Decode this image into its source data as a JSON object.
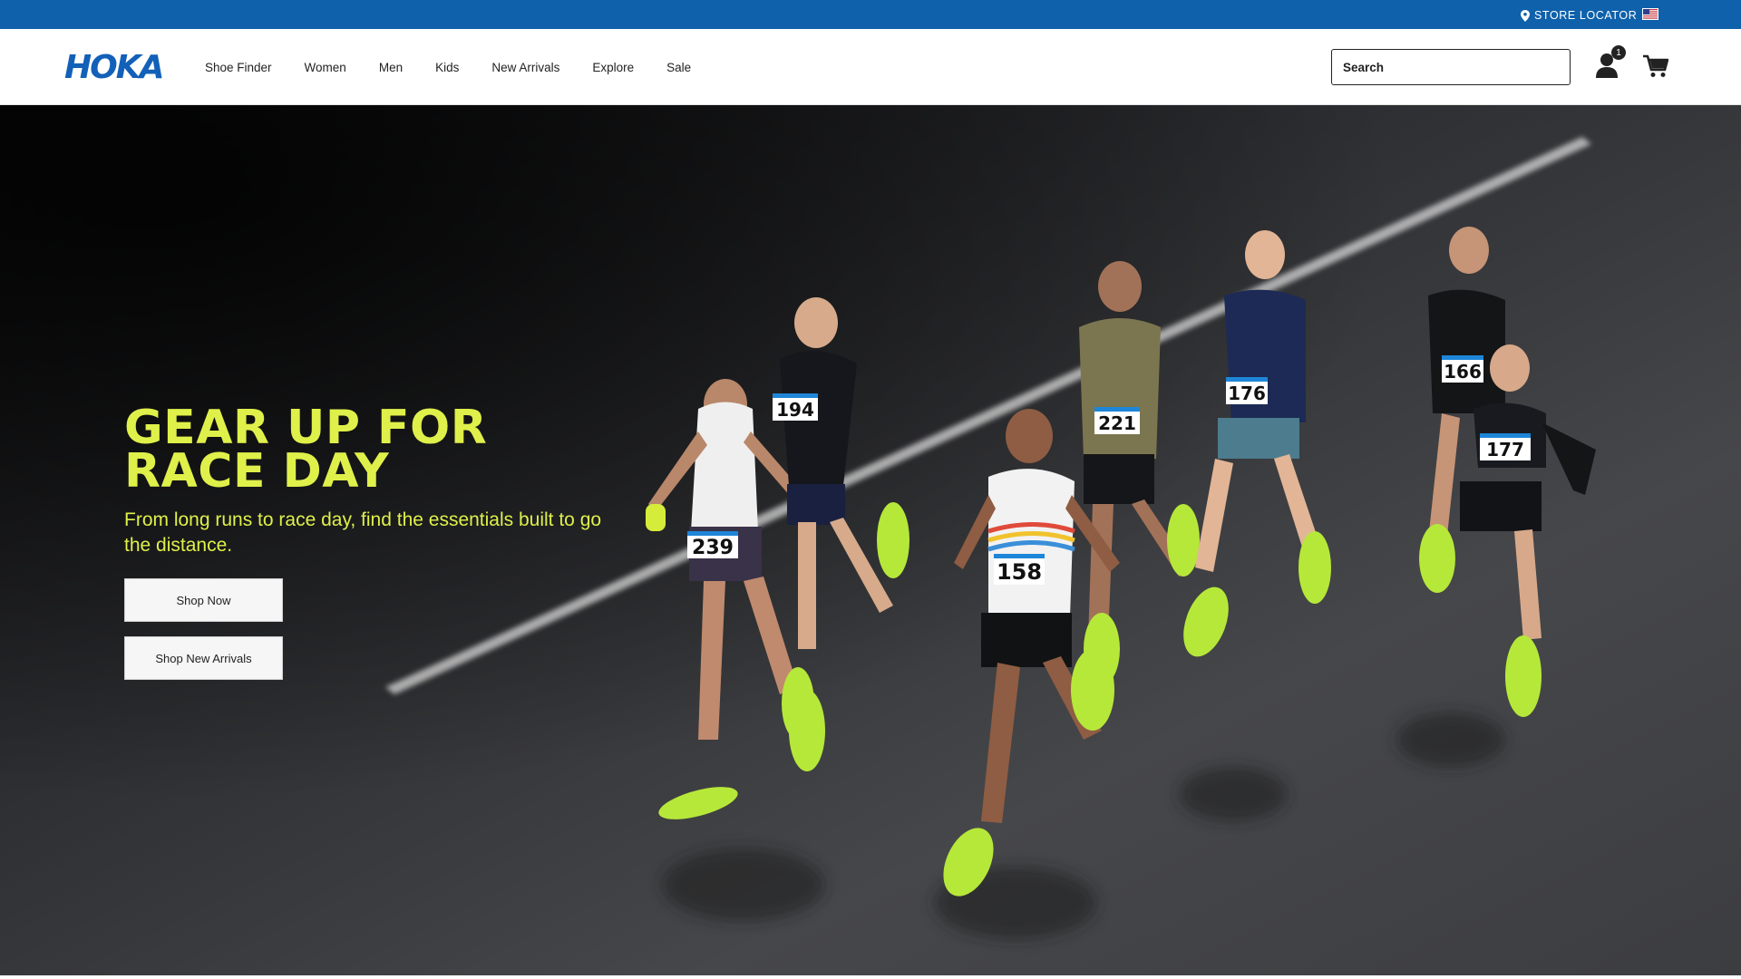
{
  "utility": {
    "store_locator": "STORE LOCATOR",
    "flag_icon": "us-flag-icon"
  },
  "header": {
    "logo_text": "HOKA",
    "nav": [
      "Shoe Finder",
      "Women",
      "Men",
      "Kids",
      "New Arrivals",
      "Explore",
      "Sale"
    ],
    "search_placeholder": "Search",
    "account_badge": "1"
  },
  "hero": {
    "title": "GEAR UP FOR RACE DAY",
    "subtitle": "From long runs to race day, find the essentials built to go the distance.",
    "button_primary": "Shop Now",
    "button_secondary": "Shop New Arrivals",
    "bibs": [
      "239",
      "194",
      "221",
      "176",
      "166",
      "158",
      "177"
    ]
  },
  "colors": {
    "utility_bar": "#0f61ab",
    "brand_logo": "#1260b8",
    "hero_accent": "#dff04a",
    "road": "#3a3b3e",
    "shoe": "#b6e83a"
  }
}
